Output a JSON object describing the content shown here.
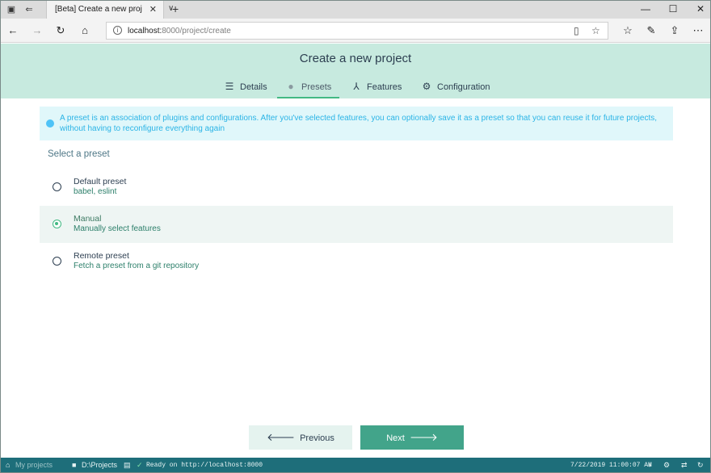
{
  "browser": {
    "tab_title": "[Beta] Create a new proj",
    "tab_close": "✕",
    "new_tab": "+",
    "tab_menu": "∨",
    "url_host": "localhost:",
    "url_rest": "8000/project/create",
    "window_controls": [
      "—",
      "☐",
      "✕"
    ]
  },
  "page": {
    "title": "Create a new project",
    "steps": [
      {
        "label": "Details",
        "icon": "list-icon"
      },
      {
        "label": "Presets",
        "icon": "check-circle-icon"
      },
      {
        "label": "Features",
        "icon": "fork-icon"
      },
      {
        "label": "Configuration",
        "icon": "settings-icon"
      }
    ],
    "active_step": "Presets",
    "info_text": "A preset is an association of plugins and configurations. After you've selected features, you can optionally save it as a preset so that you can reuse it for future projects, without having to reconfigure everything again",
    "section_title": "Select a preset",
    "presets": [
      {
        "name": "Default preset",
        "description": "babel, eslint",
        "selected": false
      },
      {
        "name": "Manual",
        "description": "Manually select features",
        "selected": true
      },
      {
        "name": "Remote preset",
        "description": "Fetch a preset from a git repository",
        "selected": false
      }
    ],
    "buttons": {
      "previous": "Previous",
      "next": "Next",
      "previous_arrow": "🡐",
      "next_arrow": "🡒"
    }
  },
  "taskbar": {
    "home_label": "My projects",
    "folder": "D:\\Projects",
    "status": "Ready on http://localhost:8000",
    "datetime": "7/22/2019 11:00:07 AM"
  },
  "colors": {
    "accent": "#42b983",
    "header_bg": "#c7eadf",
    "next_button": "#42a48a",
    "taskbar": "#1e6e7a"
  }
}
